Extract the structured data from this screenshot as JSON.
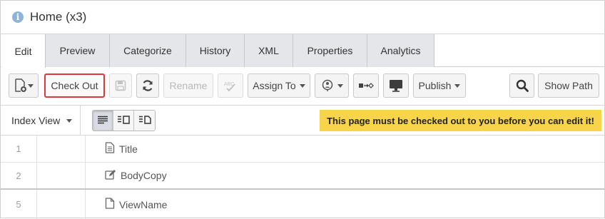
{
  "header": {
    "title": "Home (x3)",
    "icon": "info-icon"
  },
  "tabs": [
    {
      "label": "Edit",
      "active": true
    },
    {
      "label": "Preview"
    },
    {
      "label": "Categorize"
    },
    {
      "label": "History"
    },
    {
      "label": "XML"
    },
    {
      "label": "Properties"
    },
    {
      "label": "Analytics"
    }
  ],
  "toolbar": {
    "new_icon": "new-document-icon",
    "check_out_label": "Check Out",
    "save_icon": "save-icon",
    "refresh_icon": "refresh-icon",
    "rename_label": "Rename",
    "spellcheck_icon": "spellcheck-icon",
    "assign_to_label": "Assign To",
    "workflow_icon": "workflow-icon",
    "move_icon": "move-icon",
    "preview_icon": "monitor-icon",
    "publish_label": "Publish",
    "search_icon": "search-icon",
    "show_path_label": "Show Path"
  },
  "view": {
    "selector_label": "Index View",
    "modes": [
      "list-view-icon",
      "form-view-icon",
      "document-view-icon"
    ],
    "notice": "This page must be checked out to you before you can edit it!",
    "notice_color": "#f7d44a"
  },
  "rows": [
    {
      "num": "1",
      "name": "Title",
      "icon": "document-icon"
    },
    {
      "num": "2",
      "name": "BodyCopy",
      "icon": "edit-icon"
    },
    {
      "num": "5",
      "name": "ViewName",
      "icon": "file-icon"
    }
  ],
  "colors": {
    "highlight_border": "#e0363a",
    "info_icon": "#8fb4d9",
    "tab_bg": "#e5e6e9"
  }
}
